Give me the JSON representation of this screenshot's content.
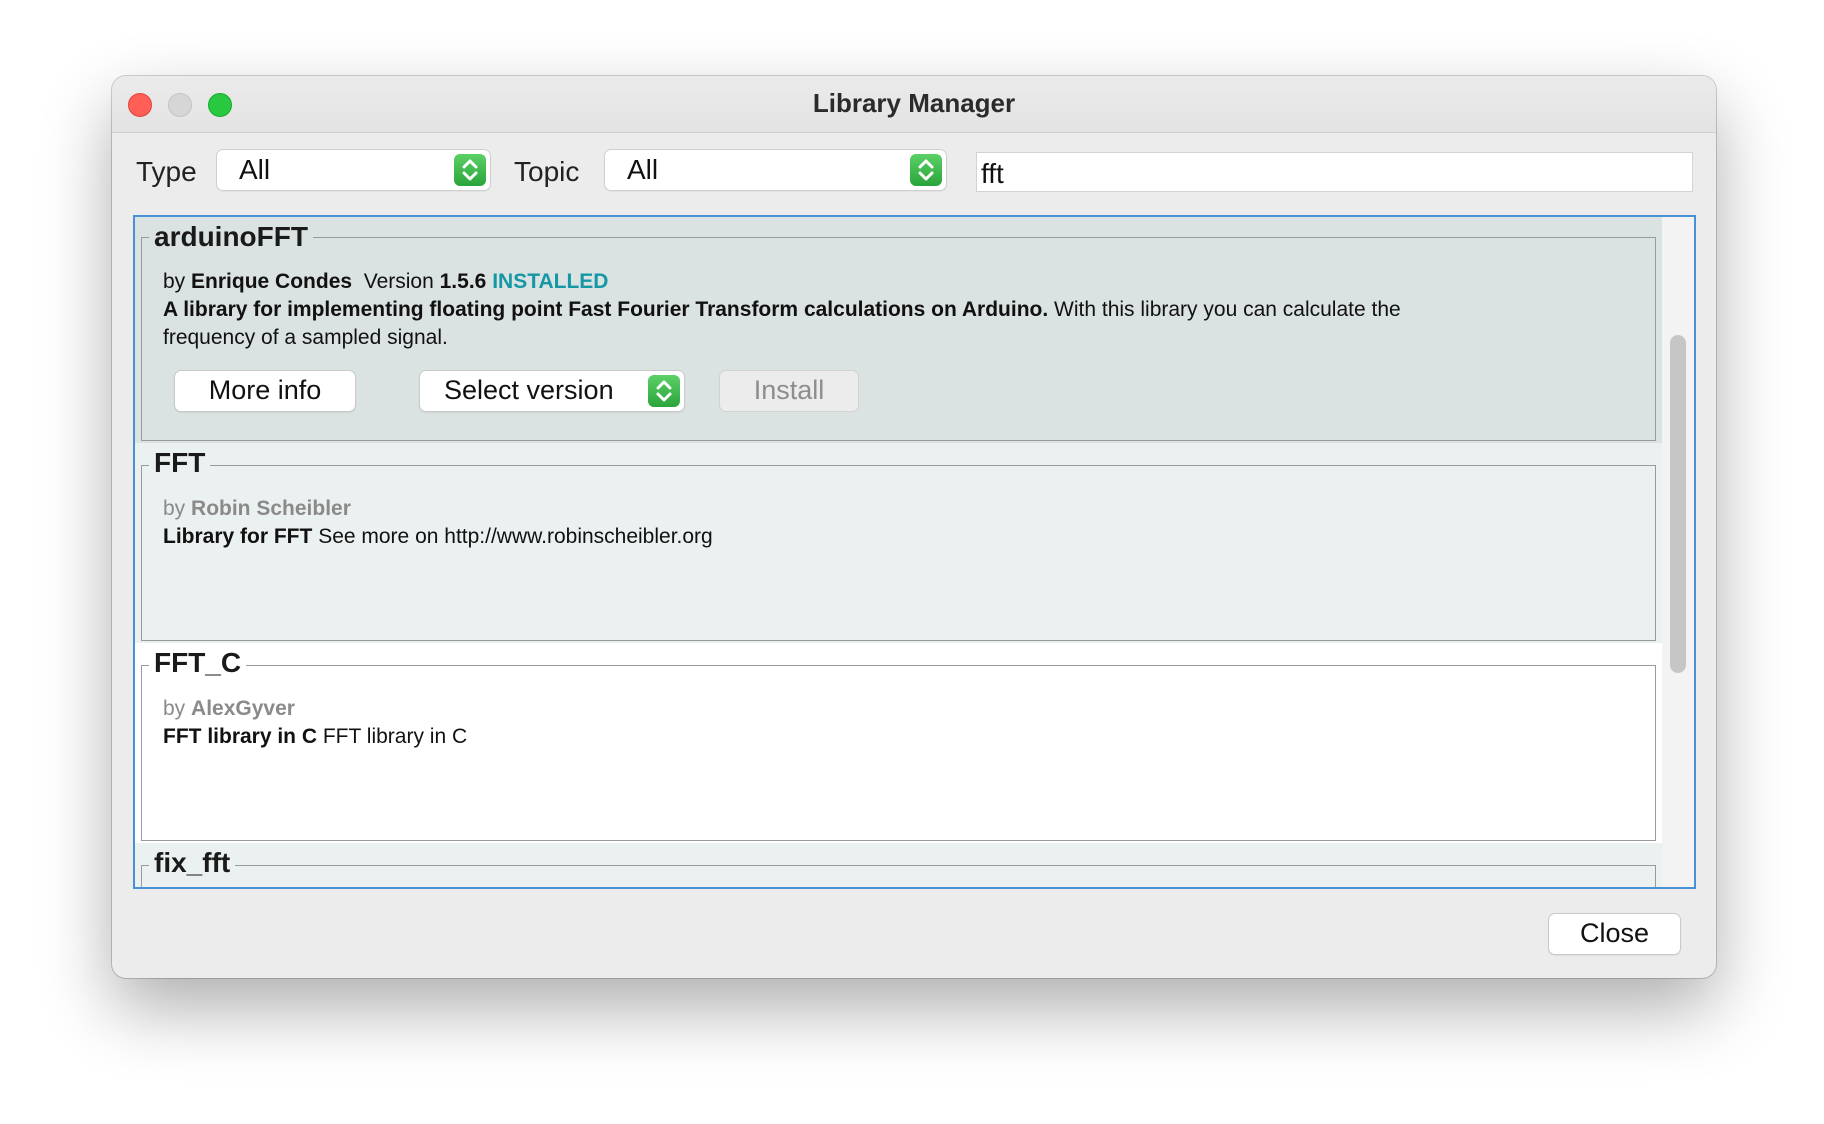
{
  "window": {
    "title": "Library Manager"
  },
  "filters": {
    "type_label": "Type",
    "type_value": "All",
    "topic_label": "Topic",
    "topic_value": "All",
    "search_value": "fft"
  },
  "libraries": [
    {
      "name": "arduinoFFT",
      "by_prefix": "by",
      "author": "Enrique Condes",
      "version_label": "Version",
      "version": "1.5.6",
      "status": "INSTALLED",
      "summary": "A library for implementing floating point Fast Fourier Transform calculations on Arduino.",
      "description_1": "With this library you can calculate the",
      "description_2": "frequency of a sampled signal.",
      "more_info_label": "More info",
      "select_version_label": "Select version",
      "install_label": "Install"
    },
    {
      "name": "FFT",
      "by_prefix": "by",
      "author": "Robin Scheibler",
      "summary": "Library for FFT",
      "description": "See more on http://www.robinscheibler.org"
    },
    {
      "name": "FFT_C",
      "by_prefix": "by",
      "author": "AlexGyver",
      "summary": "FFT library in C",
      "description": "FFT library in C"
    },
    {
      "name": "fix_fft"
    }
  ],
  "footer": {
    "close_label": "Close"
  },
  "colors": {
    "selected_row_bg": "#dbe2e2",
    "alt_row_bg": "#ebf0f0",
    "installed": "#1597a6",
    "focus_border": "#4a90d9",
    "stepper_green": "#2aa53b"
  },
  "icons": [
    "close-window-icon",
    "minimize-window-icon",
    "zoom-window-icon",
    "updown-chevron-icon"
  ]
}
